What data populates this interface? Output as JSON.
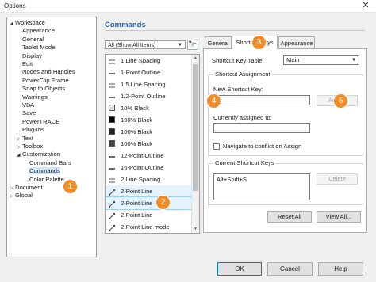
{
  "window": {
    "title": "Options",
    "close_glyph": "✕"
  },
  "tree": {
    "items": [
      {
        "label": "Workspace",
        "arrow": "◢",
        "indent": 0
      },
      {
        "label": "Appearance",
        "arrow": "",
        "indent": 1
      },
      {
        "label": "General",
        "arrow": "",
        "indent": 1
      },
      {
        "label": "Tablet Mode",
        "arrow": "",
        "indent": 1
      },
      {
        "label": "Display",
        "arrow": "",
        "indent": 1
      },
      {
        "label": "Edit",
        "arrow": "",
        "indent": 1
      },
      {
        "label": "Nodes and Handles",
        "arrow": "",
        "indent": 1
      },
      {
        "label": "PowerClip Frame",
        "arrow": "",
        "indent": 1
      },
      {
        "label": "Snap to Objects",
        "arrow": "",
        "indent": 1
      },
      {
        "label": "Warnings",
        "arrow": "",
        "indent": 1
      },
      {
        "label": "VBA",
        "arrow": "",
        "indent": 1
      },
      {
        "label": "Save",
        "arrow": "",
        "indent": 1
      },
      {
        "label": "PowerTRACE",
        "arrow": "",
        "indent": 1
      },
      {
        "label": "Plug-Ins",
        "arrow": "",
        "indent": 1
      },
      {
        "label": "Text",
        "arrow": "▷",
        "indent": 1
      },
      {
        "label": "Toolbox",
        "arrow": "▷",
        "indent": 1
      },
      {
        "label": "Customization",
        "arrow": "◢",
        "indent": 1
      },
      {
        "label": "Command Bars",
        "arrow": "",
        "indent": 2
      },
      {
        "label": "Commands",
        "arrow": "",
        "indent": 2
      },
      {
        "label": "Color Palette",
        "arrow": "",
        "indent": 2
      },
      {
        "label": "Document",
        "arrow": "▷",
        "indent": 0
      },
      {
        "label": "Global",
        "arrow": "▷",
        "indent": 0
      }
    ]
  },
  "commands": {
    "title": "Commands",
    "filter": "All (Show All Items)",
    "find_glyph": "🔭",
    "list": [
      {
        "label": "1 Line Spacing",
        "icon": "line-spacing-icon"
      },
      {
        "label": "1-Point Outline",
        "icon": "outline-icon"
      },
      {
        "label": "1.5 Line Spacing",
        "icon": "line-spacing-icon"
      },
      {
        "label": "1/2-Point Outline",
        "icon": "outline-icon"
      },
      {
        "label": "10% Black",
        "icon": "fill-swatch-icon",
        "color": "#e6e6e6"
      },
      {
        "label": "100% Black",
        "icon": "fill-swatch-icon",
        "color": "#000000"
      },
      {
        "label": "100% Black",
        "icon": "fill-swatch-icon",
        "color": "#222222"
      },
      {
        "label": "100% Black",
        "icon": "fill-swatch-icon",
        "color": "#444444"
      },
      {
        "label": "12-Point Outline",
        "icon": "outline-icon"
      },
      {
        "label": "16-Point Outline",
        "icon": "outline-icon"
      },
      {
        "label": "2 Line Spacing",
        "icon": "line-spacing-icon"
      },
      {
        "label": "2-Point Line",
        "icon": "two-point-line-icon"
      },
      {
        "label": "2-Point Line",
        "icon": "two-point-line-icon"
      },
      {
        "label": "2-Point Line",
        "icon": "two-point-line-icon"
      },
      {
        "label": "2-Point Line mode",
        "icon": "two-point-line-icon"
      }
    ]
  },
  "tabs": [
    {
      "label": "General"
    },
    {
      "label": "Shortcut Keys"
    },
    {
      "label": "Appearance"
    }
  ],
  "shortcut": {
    "table_label": "Shortcut Key Table:",
    "table_value": "Main",
    "assignment_title": "Shortcut Assignment",
    "new_key_label": "New Shortcut Key:",
    "new_key_value": "",
    "assign_label": "Assign",
    "currently_label": "Currently assigned to:",
    "currently_value": "",
    "navigate_label": "Navigate to conflict on Assign",
    "current_title": "Current Shortcut Keys",
    "current_value": "Alt+Shift+S",
    "delete_label": "Delete",
    "reset_label": "Reset All",
    "viewall_label": "View All..."
  },
  "footer": {
    "ok": "OK",
    "cancel": "Cancel",
    "help": "Help"
  },
  "callouts": [
    "1",
    "2",
    "3",
    "4",
    "5"
  ],
  "colors": {
    "accent": "#1a5fb4",
    "callout": "#f28c28",
    "selection": "#cce8ff"
  }
}
